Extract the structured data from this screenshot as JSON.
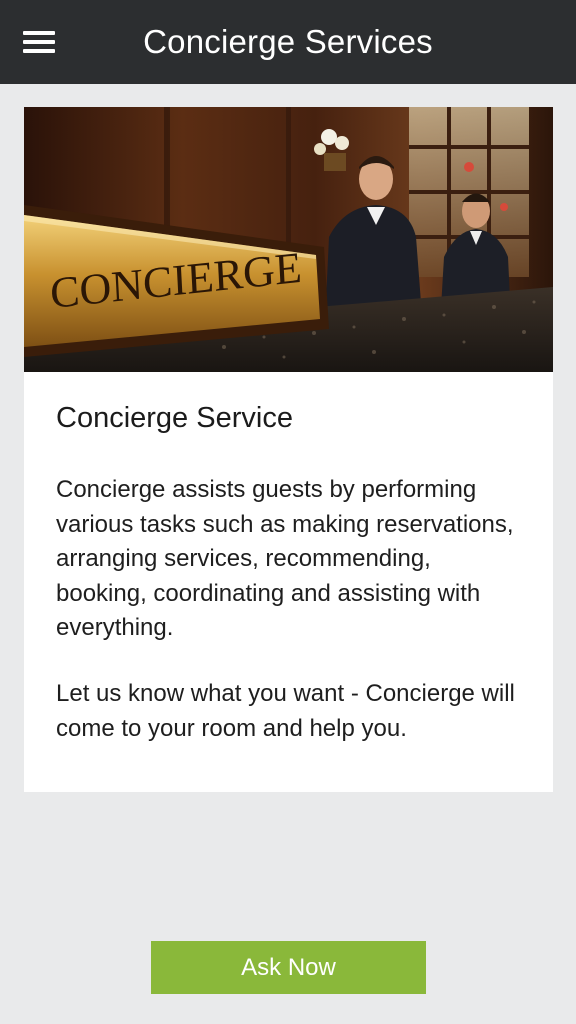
{
  "header": {
    "title": "Concierge Services",
    "menu_icon": "hamburger-menu-icon"
  },
  "card": {
    "image_sign_text": "CONCIERGE",
    "title": "Concierge Service",
    "description": "Concierge assists guests by performing various tasks such as making reservations, arranging services, recommending, booking, coordinating and assisting with everything.",
    "note": "Let us know what you want - Concierge will come to your room and help you."
  },
  "actions": {
    "ask_now_label": "Ask Now"
  },
  "colors": {
    "header_bg": "#2c2e30",
    "page_bg": "#e9eaeb",
    "button_bg": "#8ab83a"
  }
}
